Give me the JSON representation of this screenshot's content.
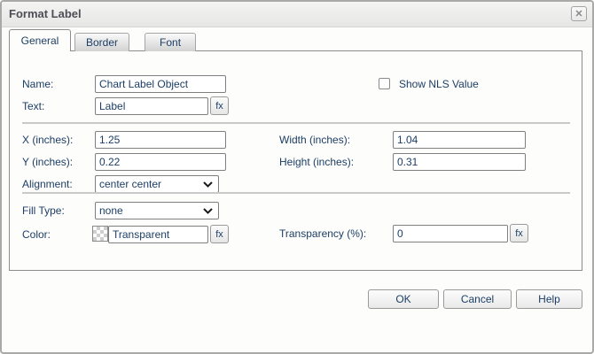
{
  "window": {
    "title": "Format Label"
  },
  "icons": {
    "close": "✕",
    "chevron_down": "⌄",
    "color_swatch": "transparent-checkerboard"
  },
  "tabs": {
    "general": "General",
    "border": "Border",
    "font": "Font",
    "active_tab": "General"
  },
  "form": {
    "name_label": "Name:",
    "name_value": "Chart Label Object",
    "text_label": "Text:",
    "text_value": "Label",
    "fx_label": "fx",
    "show_nls_label": "Show NLS Value",
    "show_nls_checked": false,
    "x_label": "X (inches):",
    "x_value": "1.25",
    "y_label": "Y (inches):",
    "y_value": "0.22",
    "alignment_label": "Alignment:",
    "alignment_value": "center center",
    "width_label": "Width (inches):",
    "width_value": "1.04",
    "height_label": "Height (inches):",
    "height_value": "0.31",
    "fill_type_label": "Fill Type:",
    "fill_type_value": "none",
    "color_label": "Color:",
    "color_value": "Transparent",
    "transparency_label": "Transparency (%):",
    "transparency_value": "0"
  },
  "buttons": {
    "ok": "OK",
    "cancel": "Cancel",
    "help": "Help"
  },
  "colors": {
    "label_text": "#1c3e66",
    "title_text": "#4e4e56",
    "dialog_border": "#a9a9a9",
    "panel_border": "#8c8c8c",
    "separator": "#c9c9c9"
  }
}
